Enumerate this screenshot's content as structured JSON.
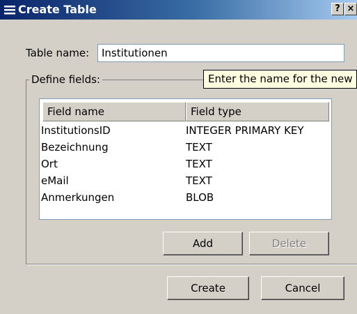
{
  "window": {
    "title": "Create Table",
    "help_button": "?",
    "close_button": "×",
    "title_icon": "table-icon"
  },
  "table_name": {
    "label": "Table name:",
    "value": "Institutionen"
  },
  "define_fields": {
    "legend": "Define fields:",
    "tooltip": "Enter the name for the new",
    "columns": [
      "Field name",
      "Field type"
    ],
    "rows": [
      {
        "name": "InstitutionsID",
        "type": "INTEGER PRIMARY KEY"
      },
      {
        "name": "Bezeichnung",
        "type": "TEXT"
      },
      {
        "name": "Ort",
        "type": "TEXT"
      },
      {
        "name": "eMail",
        "type": "TEXT"
      },
      {
        "name": "Anmerkungen",
        "type": "BLOB"
      }
    ],
    "add_label": "Add",
    "delete_label": "Delete"
  },
  "footer": {
    "create_label": "Create",
    "cancel_label": "Cancel"
  }
}
